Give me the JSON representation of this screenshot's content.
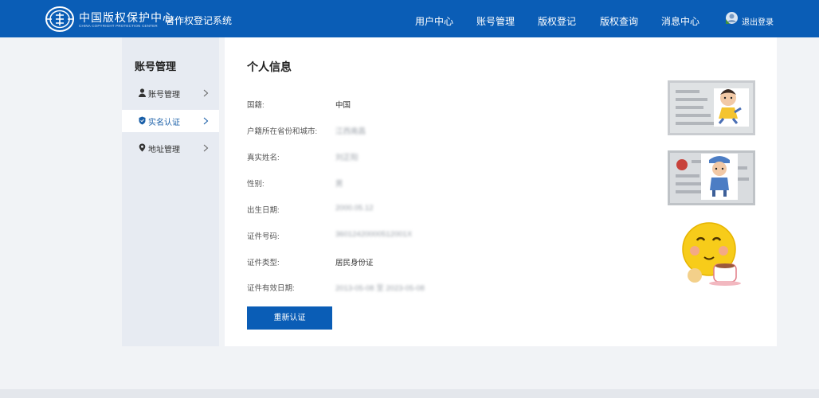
{
  "header": {
    "brand_cn": "中国版权保护中心",
    "brand_en": "CHINA COPYRIGHT PROTECTION CENTER",
    "system_name": "著作权登记系统",
    "nav": [
      "用户中心",
      "账号管理",
      "版权登记",
      "版权查询",
      "消息中心"
    ],
    "logout": "退出登录"
  },
  "sidebar": {
    "title": "账号管理",
    "items": [
      {
        "label": "账号管理",
        "icon": "user-icon",
        "active": false
      },
      {
        "label": "实名认证",
        "icon": "shield-icon",
        "active": true
      },
      {
        "label": "地址管理",
        "icon": "location-pin-icon",
        "active": false
      }
    ]
  },
  "profile": {
    "title": "个人信息",
    "rows": [
      {
        "label": "国籍:",
        "value": "中国"
      },
      {
        "label": "户籍所在省份和城市:",
        "value": "江西南昌"
      },
      {
        "label": "真实姓名:",
        "value": "刘正阳"
      },
      {
        "label": "性别:",
        "value": "男"
      },
      {
        "label": "出生日期:",
        "value": "2000.05.12"
      },
      {
        "label": "证件号码:",
        "value": "36012420000512001X"
      },
      {
        "label": "证件类型:",
        "value": "居民身份证"
      },
      {
        "label": "证件有效日期:",
        "value": "2013-05-08 至 2023-05-08"
      }
    ],
    "button": "重新认证"
  },
  "colors": {
    "header_bg": "#0a5db6",
    "button_bg": "#0a5db6",
    "sidebar_bg": "#e7ebf2",
    "page_bg": "#f1f3f6"
  }
}
